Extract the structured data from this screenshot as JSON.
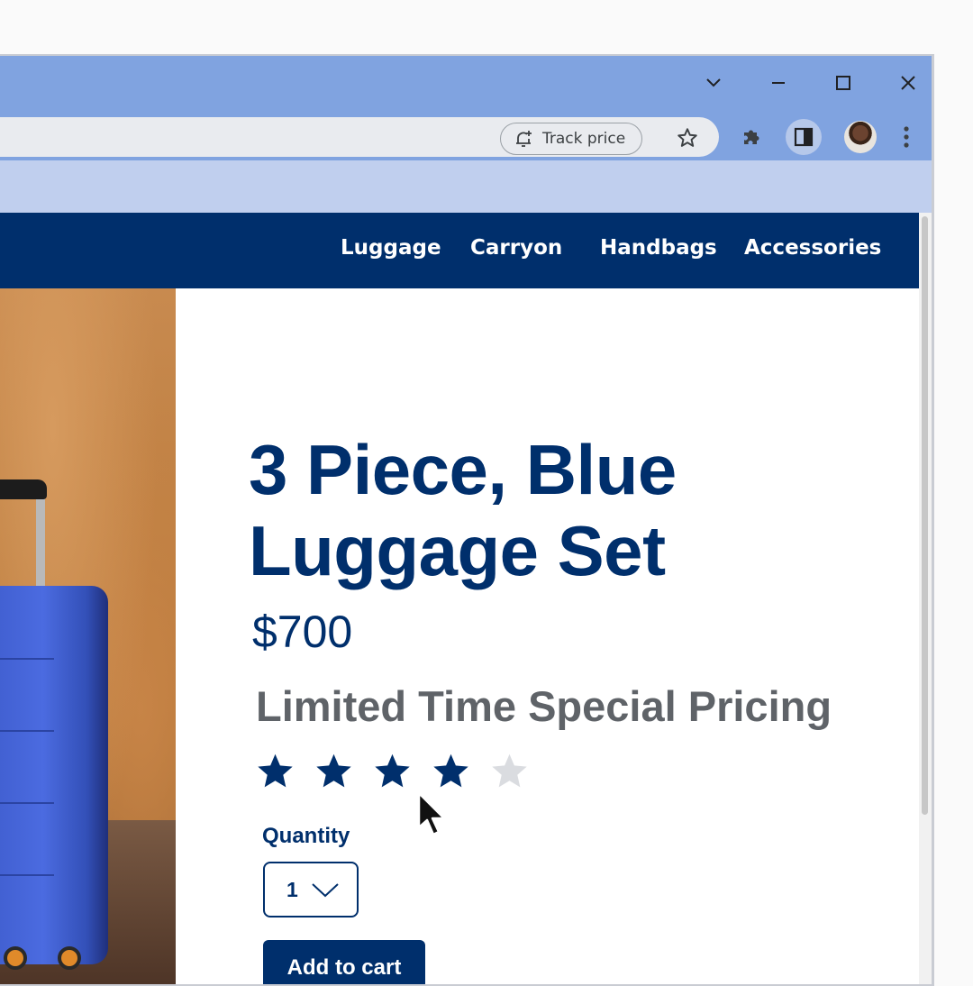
{
  "browser": {
    "track_price_label": "Track price"
  },
  "nav": {
    "items": [
      "Luggage",
      "Carryon",
      "Handbags",
      "Accessories"
    ]
  },
  "product": {
    "title_line1": "3 Piece, Blue",
    "title_line2": "Luggage Set",
    "price": "$700",
    "promo": "Limited Time Special Pricing",
    "rating": 4,
    "rating_max": 5,
    "quantity_label": "Quantity",
    "quantity_value": "1",
    "add_to_cart_label": "Add to cart"
  },
  "colors": {
    "brand_navy": "#002f6c",
    "titlebar": "#80a3e0",
    "star_filled": "#002f6c",
    "star_empty": "#dadce0"
  },
  "icons": {
    "tab_search": "chevron-down-icon",
    "minimize": "minimize-icon",
    "maximize": "maximize-icon",
    "close": "close-icon",
    "track_price": "bell-plus-icon",
    "bookmark": "star-outline-icon",
    "extensions": "puzzle-icon",
    "side_panel": "side-panel-icon",
    "menu": "kebab-menu-icon"
  }
}
